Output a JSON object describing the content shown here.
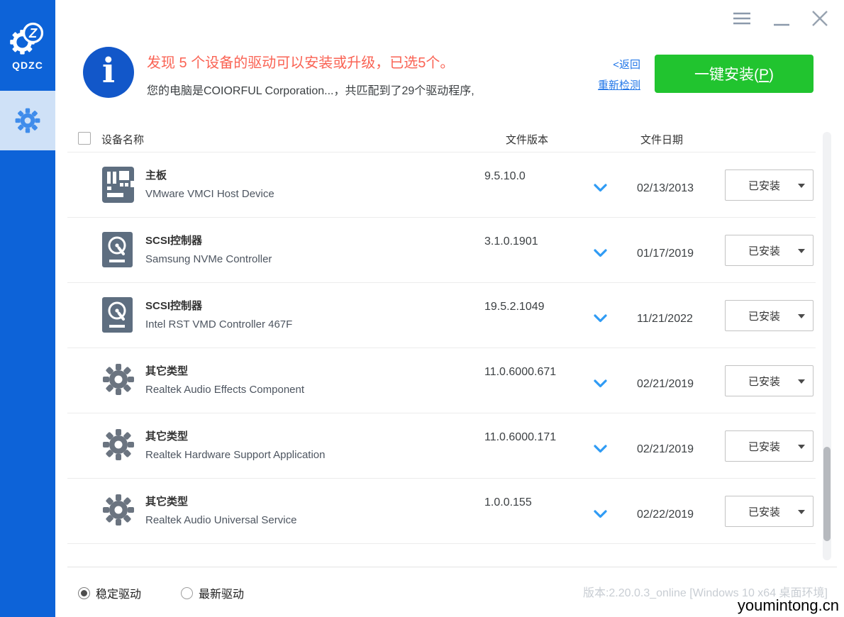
{
  "app": {
    "name": "QDZC"
  },
  "colors": {
    "sidebar": "#0d63d8",
    "selectedBg": "#cfe1f7",
    "selectedGear": "#3f8ceb",
    "infoBlue": "#1257c9",
    "red": "#fa6354",
    "link": "#2277e8",
    "green": "#21c42f",
    "chevron": "#2f9bf4",
    "iconSlate": "#5e6e80",
    "iconGray": "#6b7480"
  },
  "titlebar": {
    "menu_icon": "hamburger-menu",
    "minimize_icon": "minimize",
    "close_icon": "close"
  },
  "header": {
    "headline": "发现 5 个设备的驱动可以安装或升级，已选5个。",
    "subline": "您的电脑是COIORFUL Corporation...，共匹配到了29个驱动程序,",
    "back_link": "<返回",
    "recheck_link": "重新检测",
    "install_prefix": "一键安装(",
    "install_key": "P",
    "install_suffix": ")"
  },
  "table": {
    "columns": {
      "device": "设备名称",
      "version": "文件版本",
      "date": "文件日期"
    },
    "rows": [
      {
        "icon": "motherboard-icon",
        "category": "主板",
        "device": "VMware VMCI Host Device",
        "version": "9.5.10.0",
        "date": "02/13/2013",
        "status": "已安装"
      },
      {
        "icon": "disk-icon",
        "category": "SCSI控制器",
        "device": "Samsung NVMe Controller",
        "version": "3.1.0.1901",
        "date": "01/17/2019",
        "status": "已安装"
      },
      {
        "icon": "disk-icon",
        "category": "SCSI控制器",
        "device": "Intel RST VMD Controller 467F",
        "version": "19.5.2.1049",
        "date": "11/21/2022",
        "status": "已安装"
      },
      {
        "icon": "gear-icon",
        "category": "其它类型",
        "device": "Realtek Audio Effects Component",
        "version": "11.0.6000.671",
        "date": "02/21/2019",
        "status": "已安装"
      },
      {
        "icon": "gear-icon",
        "category": "其它类型",
        "device": "Realtek Hardware Support Application",
        "version": "11.0.6000.171",
        "date": "02/21/2019",
        "status": "已安装"
      },
      {
        "icon": "gear-icon",
        "category": "其它类型",
        "device": "Realtek Audio Universal Service",
        "version": "1.0.0.155",
        "date": "02/22/2019",
        "status": "已安装"
      }
    ]
  },
  "footer": {
    "radio_stable": "稳定驱动",
    "radio_latest": "最新驱动",
    "selected_radio": "stable",
    "version_text": "版本:2.20.0.3_online [Windows 10 x64 桌面环境]",
    "watermark": "youmintong.cn"
  }
}
